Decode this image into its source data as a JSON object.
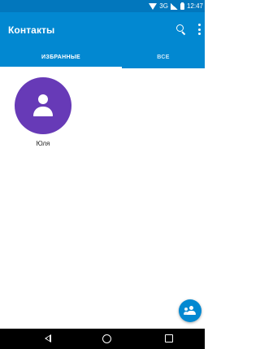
{
  "status_bar": {
    "network": "3G",
    "time": "12:47",
    "icons": [
      "wifi-icon",
      "signal-icon",
      "battery-icon"
    ]
  },
  "app_bar": {
    "title": "Контакты",
    "actions": [
      "search-icon",
      "more-icon"
    ],
    "color": "#0288d1"
  },
  "tabs": [
    {
      "label": "ИЗБРАННЫЕ",
      "selected": true
    },
    {
      "label": "ВСЕ",
      "selected": false
    }
  ],
  "favorites": [
    {
      "name": "Юля",
      "avatar_color": "#673ab7",
      "icon": "person-icon"
    }
  ],
  "fab": {
    "icon": "add-person-icon",
    "color": "#0288d1"
  },
  "nav_bar": {
    "icons": [
      "back-icon",
      "home-icon",
      "recents-icon"
    ]
  }
}
